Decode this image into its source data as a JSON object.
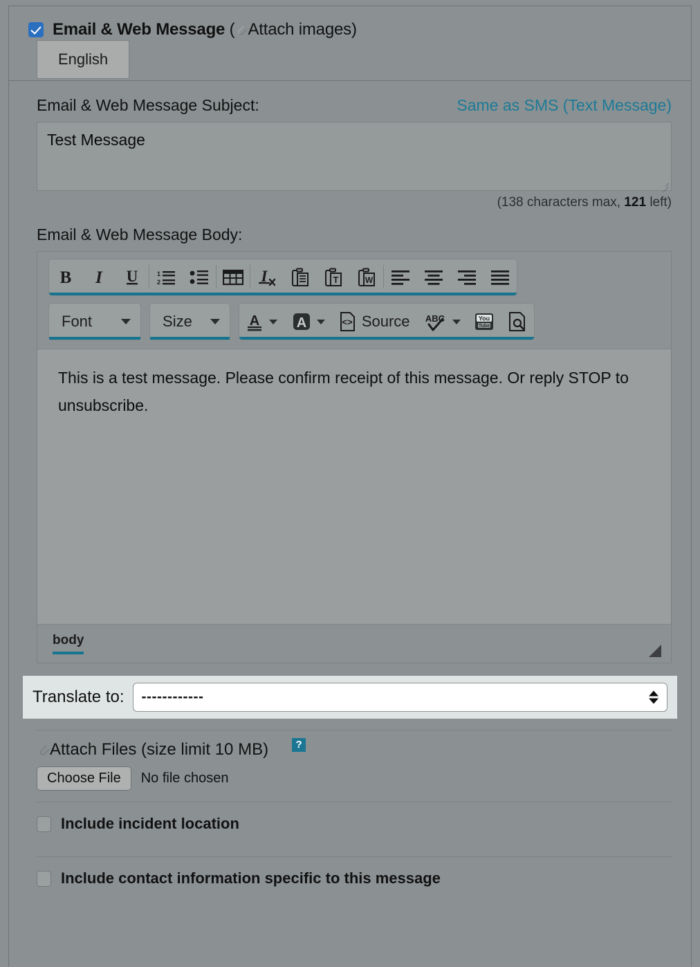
{
  "header": {
    "checkbox_checked": true,
    "title": "Email & Web Message",
    "paren_open": "(",
    "attach_images": "Attach images",
    "paren_close": ")"
  },
  "tabs": [
    {
      "label": "English",
      "active": true
    }
  ],
  "subject": {
    "label": "Email & Web Message Subject:",
    "same_as_sms_link": "Same as SMS (Text Message)",
    "value": "Test Message",
    "counter_prefix": "(138 characters max, ",
    "counter_left": "121",
    "counter_suffix": " left)"
  },
  "body": {
    "label": "Email & Web Message Body:",
    "text": "This is a test message. Please confirm receipt of this message. Or reply STOP to unsubscribe.",
    "breadcrumb": "body"
  },
  "toolbar": {
    "row1": [
      {
        "name": "bold-icon",
        "label": "B"
      },
      {
        "name": "italic-icon",
        "label": "I"
      },
      {
        "name": "underline-icon",
        "label": "U"
      },
      {
        "name": "numbered-list-icon",
        "label": "Insert/Remove Numbered List"
      },
      {
        "name": "bulleted-list-icon",
        "label": "Insert/Remove Bulleted List"
      },
      {
        "name": "table-icon",
        "label": "Table"
      },
      {
        "name": "remove-format-icon",
        "label": "Remove Format"
      },
      {
        "name": "paste-icon",
        "label": "Paste"
      },
      {
        "name": "paste-as-plain-text-icon",
        "label": "Paste as plain text"
      },
      {
        "name": "paste-from-word-icon",
        "label": "Paste from Word"
      },
      {
        "name": "align-left-icon",
        "label": "Align Left"
      },
      {
        "name": "align-center-icon",
        "label": "Center"
      },
      {
        "name": "align-right-icon",
        "label": "Align Right"
      },
      {
        "name": "justify-icon",
        "label": "Justify"
      }
    ],
    "font_label": "Font",
    "size_label": "Size",
    "text_color_label": "Text Color",
    "bg_color_label": "Background Color",
    "source_label": "Source",
    "spellcheck_label": "ABC",
    "youtube_label": "YouTube",
    "preview_label": "Preview"
  },
  "translate": {
    "label": "Translate to:",
    "selected": "------------"
  },
  "attach": {
    "label": "Attach Files (size limit 10 MB)",
    "help": "?",
    "choose_button": "Choose File",
    "file_status": "No file chosen"
  },
  "options": [
    {
      "label": "Include incident location",
      "checked": false
    },
    {
      "label": "Include contact information specific to this message",
      "checked": false
    }
  ],
  "colors": {
    "page_bg": "#8b9193",
    "accent_teal": "#15748f",
    "link": "#1c7a96",
    "checkbox_blue": "#2a6fc0",
    "translate_bg": "#dfe5e4"
  }
}
